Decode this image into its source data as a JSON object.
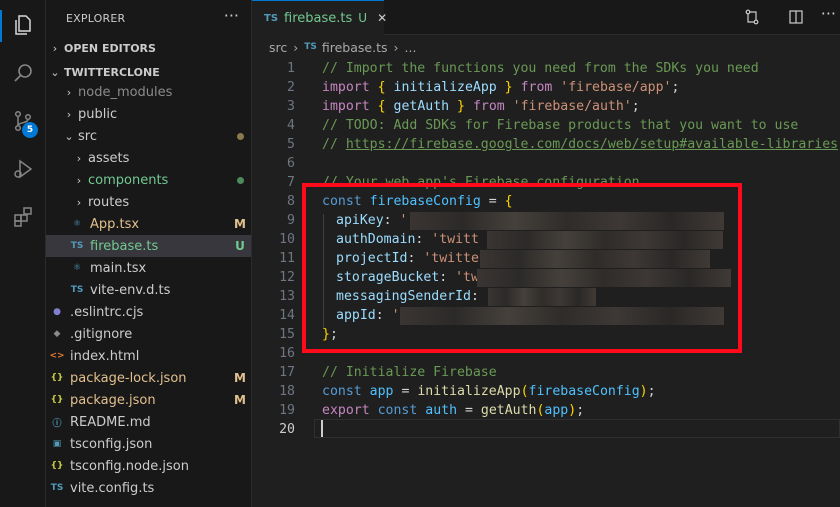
{
  "explorer": {
    "title": "EXPLORER",
    "more": "···",
    "open_editors": "OPEN EDITORS",
    "root": "TWITTERCLONE",
    "items": [
      {
        "label": "node_modules",
        "status": ""
      },
      {
        "label": "public",
        "status": ""
      },
      {
        "label": "src",
        "status": ""
      },
      {
        "label": "assets",
        "status": ""
      },
      {
        "label": "components",
        "status": ""
      },
      {
        "label": "routes",
        "status": ""
      },
      {
        "label": "App.tsx",
        "status": "M"
      },
      {
        "label": "firebase.ts",
        "status": "U"
      },
      {
        "label": "main.tsx",
        "status": ""
      },
      {
        "label": "vite-env.d.ts",
        "status": ""
      },
      {
        "label": ".eslintrc.cjs",
        "status": ""
      },
      {
        "label": ".gitignore",
        "status": ""
      },
      {
        "label": "index.html",
        "status": ""
      },
      {
        "label": "package-lock.json",
        "status": "M"
      },
      {
        "label": "package.json",
        "status": "M"
      },
      {
        "label": "README.md",
        "status": ""
      },
      {
        "label": "tsconfig.json",
        "status": ""
      },
      {
        "label": "tsconfig.node.json",
        "status": ""
      },
      {
        "label": "vite.config.ts",
        "status": ""
      }
    ]
  },
  "activity": {
    "scm_badge": "5"
  },
  "tab": {
    "type": "TS",
    "name": "firebase.ts",
    "status": "U",
    "close": "✕"
  },
  "breadcrumb": {
    "folder": "src",
    "sep": "›",
    "type": "TS",
    "file": "firebase.ts",
    "ellipsis": "..."
  },
  "code": {
    "l1": "// Import the functions you need from the SDKs you need",
    "l2a": "import",
    "l2b": "initializeApp",
    "l2c": "from",
    "l2d": "'firebase/app'",
    "l3a": "import",
    "l3b": "getAuth",
    "l3c": "from",
    "l3d": "'firebase/auth'",
    "l4": "// TODO: Add SDKs for Firebase products that you want to use",
    "l5a": "// ",
    "l5b": "https://firebase.google.com/docs/web/setup#available-libraries",
    "l7": "// Your web app's Firebase configuration",
    "l8a": "const",
    "l8b": "firebaseConfig",
    "l9a": "apiKey",
    "l9b": "'",
    "l10a": "authDomain",
    "l10b": "'twitt",
    "l11a": "projectId",
    "l11b": "'twitte",
    "l12a": "storageBucket",
    "l12b": "'tw",
    "l13a": "messagingSenderId",
    "l14a": "appId",
    "l14b": "'",
    "l17": "// Initialize Firebase",
    "l18a": "const",
    "l18b": "app",
    "l18c": "initializeApp",
    "l18d": "firebaseConfig",
    "l19a": "export",
    "l19b": "const",
    "l19c": "auth",
    "l19d": "getAuth",
    "l19e": "app"
  },
  "line_numbers": [
    "1",
    "2",
    "3",
    "4",
    "5",
    "6",
    "7",
    "8",
    "9",
    "10",
    "11",
    "12",
    "13",
    "14",
    "15",
    "16",
    "17",
    "18",
    "19",
    "20"
  ]
}
